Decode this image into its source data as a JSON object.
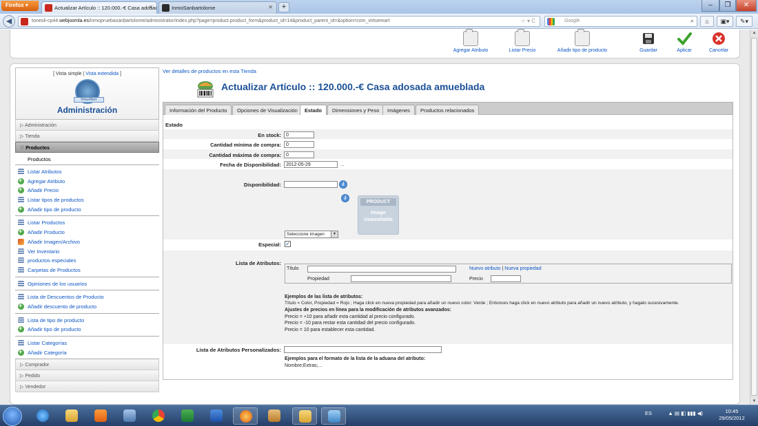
{
  "browser": {
    "firefox_label": "Firefox",
    "tabs": [
      {
        "title": "Actualizar Artículo :: 120.000.-€ Casa adosada ..."
      },
      {
        "title": "InmoSanbartolome"
      }
    ],
    "url_prefix": "toneoli-cp44.",
    "url_domain": "webjoomla.es",
    "url_rest": "/inmopruebasanbartolome/administrator/index.php?page=product.product_form&product_id=14&product_parent_id=&option=com_virtuemart",
    "search_placeholder": "Google"
  },
  "toolbar": {
    "buttons": [
      {
        "label": "Agregar Atributo"
      },
      {
        "label": "Listar Precio"
      },
      {
        "label": "Añadir tipo de producto"
      },
      {
        "label": "Guardar"
      },
      {
        "label": "Aplicar"
      },
      {
        "label": "Cancelar"
      }
    ]
  },
  "sidebar": {
    "view_open": "[ Vista simple |",
    "view_extended": "Vista extendida",
    "view_close": "]",
    "logo_text": "VirtueMart",
    "title": "Administración",
    "categories_top": [
      {
        "label": "Administración"
      },
      {
        "label": "Tienda"
      }
    ],
    "active_category": "Productos",
    "sub_label": "Productos",
    "groups": [
      [
        "Listar Atributos",
        "Agregar Atributo",
        "Añadir Precio",
        "Listar tipos de productos",
        "Añadir tipo de producto"
      ],
      [
        "Listar Productos",
        "Añadir Producto",
        "Añadir Imagen/Archivo",
        "Ver Inventario",
        "productos especiales",
        "Carpetas de Productos"
      ],
      [
        "Opiniones de los usuarios"
      ],
      [
        "Lista de Descuentos de Producto",
        "Añadir descuento de producto"
      ],
      [
        "Lista de tipo de producto",
        "Añadir tipo de producto"
      ],
      [
        "Listar Categorías",
        "Añadir Categoría"
      ]
    ],
    "categories_bottom": [
      {
        "label": "Comprador"
      },
      {
        "label": "Pedido"
      },
      {
        "label": "Vendedor"
      }
    ]
  },
  "main": {
    "top_link": "Ver detalles de productos en esta Tienda",
    "title": "Actualizar Artículo :: 120.000.-€ Casa adosada amueblada",
    "tabs": [
      {
        "label": "Información del Producto"
      },
      {
        "label": "Opciones de Visualización"
      },
      {
        "label": "Estado"
      },
      {
        "label": "Dimensiones y Peso"
      },
      {
        "label": "Imágenes"
      },
      {
        "label": "Productos relacionados"
      }
    ],
    "section": "Estado",
    "fields": {
      "en_stock_label": "En stock:",
      "en_stock_value": "0",
      "cant_min_label": "Cantidad mínima de compra:",
      "cant_min_value": "0",
      "cant_max_label": "Cantidad máxima de compra:",
      "cant_max_value": "0",
      "fecha_label": "Fecha de Disponibilidad:",
      "fecha_value": "2012-05-29",
      "fecha_btn": "...",
      "disponibilidad_label": "Disponibilidad:",
      "disponibilidad_value": "",
      "no_image_top": "PRODUCT",
      "no_image_l1": "Image",
      "no_image_l2": "Unavailable",
      "select_image": "Seleccione imagen",
      "especial_label": "Especial:",
      "especial_checked": "✓",
      "attr_list_label": "Lista de Atributos:",
      "titulo_label": "Título",
      "nuevo_atributo": "Nuevo atributo",
      "sep": "|",
      "nueva_propiedad": "Nueva propiedad",
      "propiedad_label": "Propiedad",
      "precio_label": "Precio",
      "custom_attr_label": "Lista de Atributos Personalizados:"
    },
    "examples": {
      "h1": "Ejemplos de las lista de atributos:",
      "l1": "Título = Color, Propiedad = Rojo ; Haga click en nueva propiedad para añadir un nuevo color: Verde ; Entonces haga click en nuevo atributo para añadir un nuevo atributo, y hagalo sucesivamente.",
      "h2": "Ajustes de precios en línea para la modificación de atributos avanzados:",
      "l2": "Precio = +10 para añadir esta cantidad al precio configurado.",
      "l3": "Precio = -10 para restar esta cantidad del precio configurado.",
      "l4": "Precio = 10 para establecer esta cantidad.",
      "h3": "Ejemplos para el formato de la lista de la aduana del atributo:",
      "l5": "Nombre;Extras;..."
    }
  },
  "taskbar": {
    "lang": "ES",
    "time": "10:45",
    "date": "29/05/2012"
  }
}
